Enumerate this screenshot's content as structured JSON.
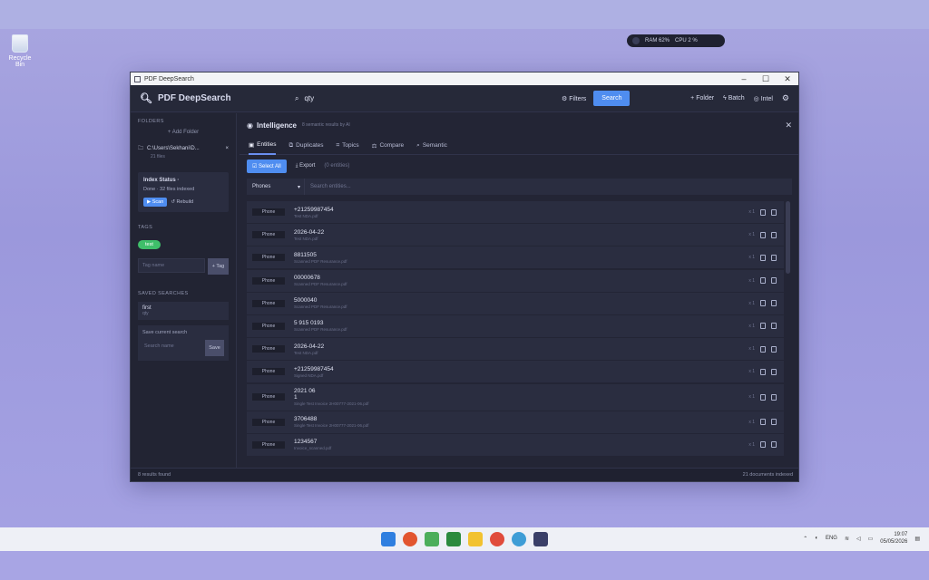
{
  "desktop": {
    "recycle_bin_label": "Recycle Bin"
  },
  "sysmon": {
    "ram": "RAM 62%",
    "cpu": "CPU 2 %"
  },
  "window": {
    "title": "PDF DeepSearch"
  },
  "header": {
    "brand": "PDF DeepSearch",
    "search_value": "qty",
    "filters_label": "Filters",
    "search_label": "Search",
    "add_folder_label": "+ Folder",
    "batch_label": "Batch",
    "intel_label": "Intel"
  },
  "sidebar": {
    "folders_title": "FOLDERS",
    "add_folder": "+ Add Folder",
    "folder_path": "C:\\Users\\Sekhani\\D...",
    "folder_sub": "21 files",
    "index_title": "Index Status",
    "index_status": "Done · 32 files indexed",
    "scan_label": "Scan",
    "rebuild_label": "Rebuild",
    "tags_title": "TAGS",
    "tag_pill": "test",
    "tag_placeholder": "Tag name",
    "tag_add": "+ Tag",
    "saved_title": "SAVED SEARCHES",
    "saved_name": "first",
    "saved_query": "qty",
    "save_label": "Save current search",
    "save_placeholder": "Search name",
    "save_btn": "Save"
  },
  "panel": {
    "title": "Intelligence",
    "subtitle": "8 semantic results by AI",
    "tabs": [
      "Entities",
      "Duplicates",
      "Topics",
      "Compare",
      "Semantic"
    ],
    "select_all": "Select All",
    "export": "Export",
    "selected_count": "(0 entities)",
    "filter_type": "Phones",
    "filter_placeholder": "Search entities..."
  },
  "entities": [
    {
      "type": "Phone",
      "value": "+21259987454",
      "source": "Test NDA.pdf",
      "meta": "x 1"
    },
    {
      "type": "Phone",
      "value": "2026-04-22",
      "source": "Test NDA.pdf",
      "meta": "x 1"
    },
    {
      "type": "Phone",
      "value": "8811505",
      "source": "Scanned PDF Resurance.pdf",
      "meta": "x 1"
    },
    {
      "type": "Phone",
      "value": "00000678",
      "source": "Scanned PDF Resurance.pdf",
      "meta": "x 1"
    },
    {
      "type": "Phone",
      "value": "5000040",
      "source": "Scanned PDF Resurance.pdf",
      "meta": "x 1"
    },
    {
      "type": "Phone",
      "value": "5 915 0193",
      "source": "Scanned PDF Resurance.pdf",
      "meta": "x 1"
    },
    {
      "type": "Phone",
      "value": "2026-04-22",
      "source": "Test NDA.pdf",
      "meta": "x 1"
    },
    {
      "type": "Phone",
      "value": "+21259987454",
      "source": "Signed NDA.pdf",
      "meta": "x 1"
    },
    {
      "type": "Phone",
      "value": "2021 06\n1",
      "source": "Single Test Invoice 2H00777-2021-06.pdf",
      "meta": "x 1"
    },
    {
      "type": "Phone",
      "value": "3706488",
      "source": "Single Test Invoice 2H00777-2021-06.pdf",
      "meta": "x 1"
    },
    {
      "type": "Phone",
      "value": "1234567",
      "source": "Invoice_scanned.pdf",
      "meta": "x 1"
    }
  ],
  "statusbar": {
    "left": "8 results found",
    "right": "21 documents indexed"
  },
  "tray": {
    "lang": "ENG",
    "time": "19:07",
    "date": "05/05/2026"
  }
}
